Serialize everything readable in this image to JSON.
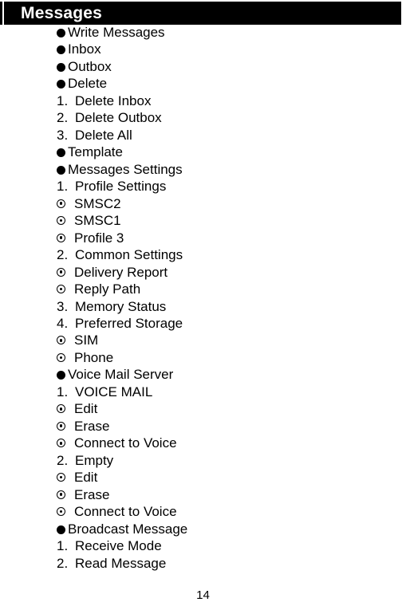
{
  "header": {
    "title": "Messages"
  },
  "outline": {
    "rows": [
      {
        "type": "bullet",
        "marker": "●",
        "label": "Write Messages"
      },
      {
        "type": "bullet",
        "marker": "●",
        "label": "Inbox"
      },
      {
        "type": "bullet",
        "marker": "●",
        "label": "Outbox"
      },
      {
        "type": "bullet",
        "marker": "●",
        "label": "Delete"
      },
      {
        "type": "numbered",
        "marker": "1.",
        "label": "Delete Inbox"
      },
      {
        "type": "numbered",
        "marker": "2.",
        "label": "Delete Outbox"
      },
      {
        "type": "numbered",
        "marker": "3.",
        "label": "Delete All"
      },
      {
        "type": "bullet",
        "marker": "●",
        "label": "Template"
      },
      {
        "type": "bullet",
        "marker": "●",
        "label": "Messages Settings"
      },
      {
        "type": "numbered",
        "marker": "1.",
        "label": "Profile Settings"
      },
      {
        "type": "radio",
        "marker": "⊙",
        "label": "SMSC2"
      },
      {
        "type": "radio",
        "marker": "⊙",
        "label": "SMSC1"
      },
      {
        "type": "radio",
        "marker": "⊙",
        "label": "Profile 3"
      },
      {
        "type": "numbered",
        "marker": "2.",
        "label": "Common Settings"
      },
      {
        "type": "radio",
        "marker": "⊙",
        "label": "Delivery Report"
      },
      {
        "type": "radio",
        "marker": "⊙",
        "label": "Reply Path"
      },
      {
        "type": "numbered",
        "marker": "3.",
        "label": "Memory Status"
      },
      {
        "type": "numbered",
        "marker": "4.",
        "label": "Preferred Storage"
      },
      {
        "type": "radio",
        "marker": "⊙",
        "label": "SIM"
      },
      {
        "type": "radio",
        "marker": "⊙",
        "label": "Phone"
      },
      {
        "type": "bullet",
        "marker": "●",
        "label": "Voice Mail Server"
      },
      {
        "type": "numbered",
        "marker": "1.",
        "label": "VOICE MAIL"
      },
      {
        "type": "radio",
        "marker": "⊙",
        "label": "Edit"
      },
      {
        "type": "radio",
        "marker": "⊙",
        "label": "Erase"
      },
      {
        "type": "radio",
        "marker": "⊙",
        "label": "Connect to Voice"
      },
      {
        "type": "numbered",
        "marker": "2.",
        "label": "Empty"
      },
      {
        "type": "radio",
        "marker": "⊙",
        "label": "Edit"
      },
      {
        "type": "radio",
        "marker": "⊙",
        "label": "Erase"
      },
      {
        "type": "radio",
        "marker": "⊙",
        "label": "Connect to Voice"
      },
      {
        "type": "bullet",
        "marker": "●",
        "label": "Broadcast Message"
      },
      {
        "type": "numbered",
        "marker": "1.",
        "label": "Receive Mode"
      },
      {
        "type": "numbered",
        "marker": "2.",
        "label": "Read Message"
      }
    ]
  },
  "footer": {
    "page_number": "14"
  },
  "colors": {
    "header_background": "#000000",
    "header_text": "#ffffff",
    "body_text": "#000000",
    "page_background": "#ffffff"
  }
}
